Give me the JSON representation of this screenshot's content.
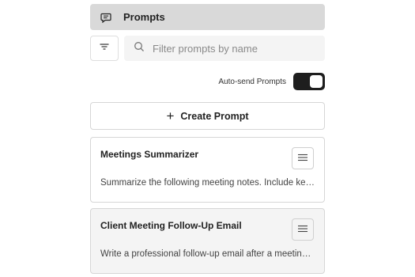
{
  "header": {
    "title": "Prompts",
    "icon": "chat-bubble-icon"
  },
  "filter": {
    "icon": "filter-icon"
  },
  "search": {
    "placeholder": "Filter prompts by name",
    "value": "",
    "icon": "search-icon"
  },
  "auto_send": {
    "label": "Auto-send Prompts",
    "enabled": true
  },
  "create_button": {
    "label": "Create Prompt",
    "icon": "plus-icon"
  },
  "prompts": [
    {
      "title": "Meetings Summarizer",
      "description": "Summarize the following meeting notes. Include key decisions, action items, and owners."
    },
    {
      "title": "Client Meeting Follow-Up Email",
      "description": "Write a professional follow-up email after a meeting with a client."
    }
  ],
  "colors": {
    "header_bg": "#d9d9d9",
    "toggle_on": "#1e1e1e",
    "search_bg": "#f4f4f4",
    "card_alt_bg": "#f4f4f4"
  }
}
